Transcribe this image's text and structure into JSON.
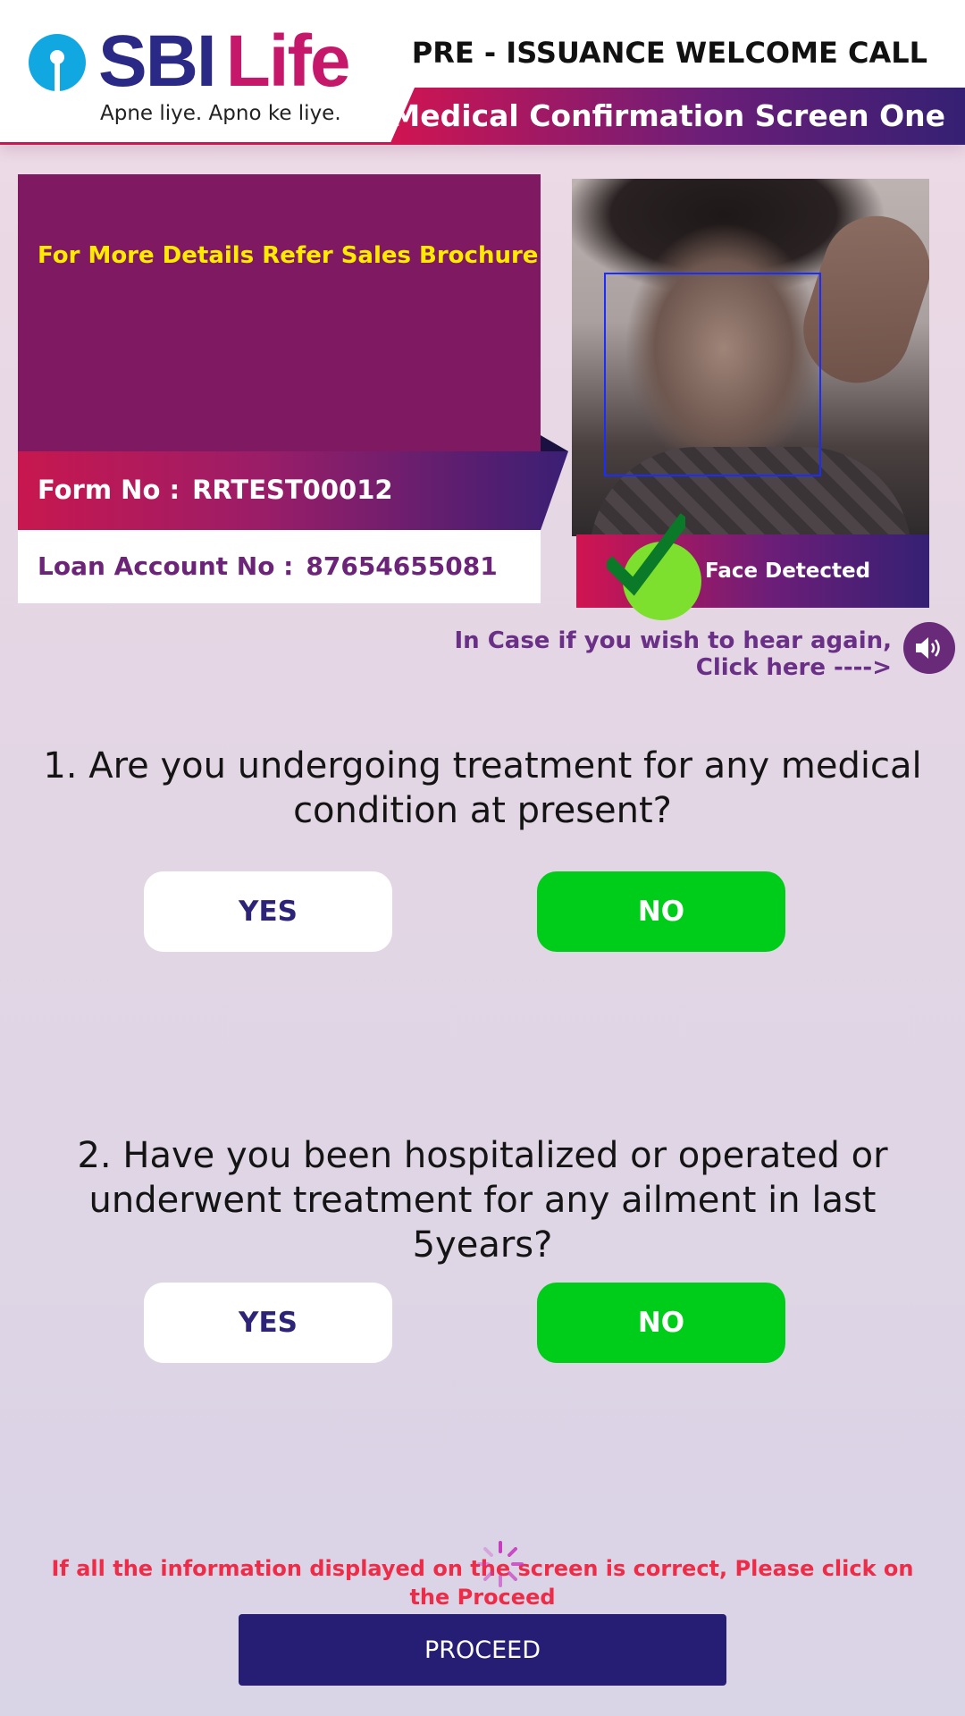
{
  "header": {
    "logo_sbi": "SBI",
    "logo_life": "Life",
    "tagline": "Apne liye. Apno ke liye.",
    "title": "PRE - ISSUANCE WELCOME CALL",
    "subtitle": "Medical Confirmation Screen One"
  },
  "info": {
    "brochure_text": "For More Details Refer Sales Brochure",
    "form_no_label": "Form No :",
    "form_no_value": "RRTEST00012",
    "loan_label": "Loan Account No :",
    "loan_value": "87654655081"
  },
  "camera": {
    "status": "Face Detected"
  },
  "hear_again": {
    "line1": "In Case if you wish to hear again,",
    "line2": "Click here ---->",
    "icon": "speaker-icon"
  },
  "questions": [
    {
      "text": "1. Are you undergoing treatment for any medical condition at present?",
      "yes_label": "YES",
      "no_label": "NO",
      "selected": "NO"
    },
    {
      "text": "2. Have you been hospitalized or operated or underwent treatment for any ailment in last 5years?",
      "yes_label": "YES",
      "no_label": "NO",
      "selected": "NO"
    }
  ],
  "footer": {
    "confirm_text": "If all the information displayed on the screen is correct, Please click on the Proceed",
    "proceed_label": "PROCEED"
  },
  "colors": {
    "brand_navy": "#261d74",
    "brand_magenta": "#7f1a62",
    "brand_red": "#d11451",
    "selected_green": "#00cc1a",
    "warning_red": "#ee2c48",
    "brochure_yellow": "#ffea00"
  }
}
